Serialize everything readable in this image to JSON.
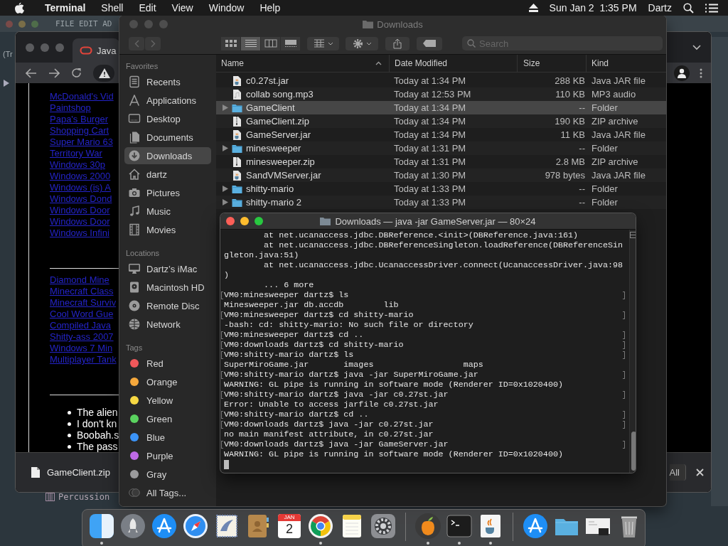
{
  "menubar": {
    "app": "Terminal",
    "menus": [
      "Shell",
      "Edit",
      "View",
      "Window",
      "Help"
    ],
    "clock": "Sun Jan 2  1:35 PM",
    "user": "Dartz"
  },
  "background_app": {
    "menu": "FILE EDIT AD",
    "label": "(Tr",
    "channel": "Percussion"
  },
  "browser": {
    "tab_title": "Java",
    "links_top": [
      "McDonald's Vid",
      "Paintshop",
      "Papa's Burger",
      "Shopping Cart",
      "Super Mario 63",
      "Territory War",
      "Windows 30p",
      "Windows 2000",
      "Windows (is) A",
      "Windows Dond",
      "Windows Door",
      "Windows Door",
      "Windows Infini"
    ],
    "links_bottom": [
      "Diamond Mine",
      "Minecraft Class",
      "Minecraft Surviv",
      "Cool Word Gue",
      "Compiled Java",
      "Shitty-ass 2007",
      "Windows 7 Min",
      "Multiplayer Tank"
    ],
    "bullets": [
      "The alien",
      "I don't kn",
      "Boobah.s",
      "The pass"
    ],
    "download": {
      "file": "GameClient.zip",
      "button": "All"
    }
  },
  "finder": {
    "title": "Downloads",
    "views": [
      {
        "kind": "icons",
        "selected": false
      },
      {
        "kind": "list",
        "selected": true
      },
      {
        "kind": "columns",
        "selected": false
      },
      {
        "kind": "gallery",
        "selected": false
      }
    ],
    "search": {
      "placeholder": "Search"
    },
    "sections": [
      {
        "heading": "Favorites",
        "items": [
          {
            "label": "Recents",
            "kind": "recents",
            "selected": false
          },
          {
            "label": "Applications",
            "kind": "applications",
            "selected": false
          },
          {
            "label": "Desktop",
            "kind": "desktop",
            "selected": false
          },
          {
            "label": "Documents",
            "kind": "documents",
            "selected": false
          },
          {
            "label": "Downloads",
            "kind": "downloads",
            "selected": true
          },
          {
            "label": "dartz",
            "kind": "home",
            "selected": false
          },
          {
            "label": "Pictures",
            "kind": "pictures",
            "selected": false
          },
          {
            "label": "Music",
            "kind": "music",
            "selected": false
          },
          {
            "label": "Movies",
            "kind": "movies",
            "selected": false
          }
        ]
      },
      {
        "heading": "Locations",
        "items": [
          {
            "label": "Dartz’s iMac",
            "kind": "imac",
            "selected": false
          },
          {
            "label": "Macintosh HD",
            "kind": "hd",
            "selected": false
          },
          {
            "label": "Remote Disc",
            "kind": "disc",
            "selected": false
          },
          {
            "label": "Network",
            "kind": "network",
            "selected": false
          }
        ]
      }
    ],
    "tags": {
      "heading": "Tags",
      "items": [
        {
          "label": "Red",
          "color": "#f0585a",
          "selected": false
        },
        {
          "label": "Orange",
          "color": "#f5a83c",
          "selected": false
        },
        {
          "label": "Yellow",
          "color": "#f7d843",
          "selected": false
        },
        {
          "label": "Green",
          "color": "#5ad25f",
          "selected": false
        },
        {
          "label": "Blue",
          "color": "#3b93f7",
          "selected": false
        },
        {
          "label": "Purple",
          "color": "#bf6ae6",
          "selected": false
        },
        {
          "label": "Gray",
          "color": "#9a9a9c",
          "selected": false
        }
      ],
      "all": "All Tags..."
    },
    "columns": [
      {
        "label": "Name",
        "sorted": true
      },
      {
        "label": "Date Modified",
        "sorted": false
      },
      {
        "label": "Size",
        "sorted": false
      },
      {
        "label": "Kind",
        "sorted": false
      }
    ],
    "rows": [
      {
        "name": "c0.27st.jar",
        "date": "Today at 1:34 PM",
        "size": "288 KB",
        "file_kind": "Java JAR file",
        "kind": "jar",
        "selected": false
      },
      {
        "name": "collab song.mp3",
        "date": "Today at 12:53 PM",
        "size": "110 KB",
        "file_kind": "MP3 audio",
        "kind": "mp3",
        "selected": false
      },
      {
        "name": "GameClient",
        "date": "Today at 1:34 PM",
        "size": "--",
        "file_kind": "Folder",
        "kind": "folder",
        "selected": true
      },
      {
        "name": "GameClient.zip",
        "date": "Today at 1:34 PM",
        "size": "190 KB",
        "file_kind": "ZIP archive",
        "kind": "zip",
        "selected": false
      },
      {
        "name": "GameServer.jar",
        "date": "Today at 1:34 PM",
        "size": "11 KB",
        "file_kind": "Java JAR file",
        "kind": "jar",
        "selected": false
      },
      {
        "name": "minesweeper",
        "date": "Today at 1:31 PM",
        "size": "--",
        "file_kind": "Folder",
        "kind": "folder",
        "selected": false
      },
      {
        "name": "minesweeper.zip",
        "date": "Today at 1:31 PM",
        "size": "2.8 MB",
        "file_kind": "ZIP archive",
        "kind": "zip",
        "selected": false
      },
      {
        "name": "SandVMServer.jar",
        "date": "Today at 1:30 PM",
        "size": "978 bytes",
        "file_kind": "Java JAR file",
        "kind": "jar",
        "selected": false
      },
      {
        "name": "shitty-mario",
        "date": "Today at 1:33 PM",
        "size": "--",
        "file_kind": "Folder",
        "kind": "folder",
        "selected": false
      },
      {
        "name": "shitty-mario 2",
        "date": "Today at 1:33 PM",
        "size": "--",
        "file_kind": "Folder",
        "kind": "folder",
        "selected": false
      }
    ]
  },
  "terminal": {
    "title": "Downloads — java -jar GameServer.jar — 80×24",
    "lines": [
      {
        "text": "        at net.ucanaccess.jdbc.DBReference.<init>(DBReference.java:161)",
        "marked": false
      },
      {
        "text": "        at net.ucanaccess.jdbc.DBReferenceSingleton.loadReference(DBReferenceSin",
        "marked": false
      },
      {
        "text": "gleton.java:51)",
        "marked": false
      },
      {
        "text": "        at net.ucanaccess.jdbc.UcanaccessDriver.connect(UcanaccessDriver.java:98",
        "marked": false
      },
      {
        "text": ")",
        "marked": false
      },
      {
        "text": "        ... 6 more",
        "marked": false
      },
      {
        "text": "VM0:minesweeper dartz$ ls",
        "marked": true
      },
      {
        "text": "Minesweeper.jar db.accdb        lib",
        "marked": false
      },
      {
        "text": "VM0:minesweeper dartz$ cd shitty-mario",
        "marked": true
      },
      {
        "text": "-bash: cd: shitty-mario: No such file or directory",
        "marked": false
      },
      {
        "text": "VM0:minesweeper dartz$ cd ..",
        "marked": true
      },
      {
        "text": "VM0:downloads dartz$ cd shitty-mario",
        "marked": true
      },
      {
        "text": "VM0:shitty-mario dartz$ ls",
        "marked": true
      },
      {
        "text": "SuperMiroGame.jar       images                  maps",
        "marked": false
      },
      {
        "text": "VM0:shitty-mario dartz$ java -jar SuperMiroGame.jar",
        "marked": true
      },
      {
        "text": "WARNING: GL pipe is running in software mode (Renderer ID=0x1020400)",
        "marked": false
      },
      {
        "text": "VM0:shitty-mario dartz$ java -jar c0.27st.jar",
        "marked": true
      },
      {
        "text": "Error: Unable to access jarfile c0.27st.jar",
        "marked": false
      },
      {
        "text": "VM0:shitty-mario dartz$ cd ..",
        "marked": true
      },
      {
        "text": "VM0:downloads dartz$ java -jar c0.27st.jar",
        "marked": true
      },
      {
        "text": "no main manifest attribute, in c0.27st.jar",
        "marked": false
      },
      {
        "text": "VM0:downloads dartz$ java -jar GameServer.jar",
        "marked": true
      },
      {
        "text": "WARNING: GL pipe is running in software mode (Renderer ID=0x1020400)",
        "marked": false
      }
    ]
  },
  "dock": {
    "groups": [
      {
        "items": [
          {
            "kind": "finder",
            "running": true
          },
          {
            "kind": "launchpad",
            "running": false
          },
          {
            "kind": "appstore",
            "running": false
          },
          {
            "kind": "safari",
            "running": false
          },
          {
            "kind": "mail",
            "running": false
          },
          {
            "kind": "contacts",
            "running": false
          },
          {
            "kind": "calendar",
            "month": "JAN",
            "day": "2",
            "running": false
          },
          {
            "kind": "chrome",
            "running": true
          },
          {
            "kind": "notes",
            "running": false
          },
          {
            "kind": "settings",
            "running": false
          }
        ]
      },
      {
        "items": [
          {
            "kind": "fl",
            "running": true
          },
          {
            "kind": "terminal",
            "running": true
          },
          {
            "kind": "java",
            "running": true
          }
        ]
      },
      {
        "items": [
          {
            "kind": "appstore",
            "running": false
          },
          {
            "kind": "folder",
            "running": false
          },
          {
            "kind": "preview",
            "running": false
          },
          {
            "kind": "trash",
            "running": false
          }
        ]
      }
    ]
  }
}
